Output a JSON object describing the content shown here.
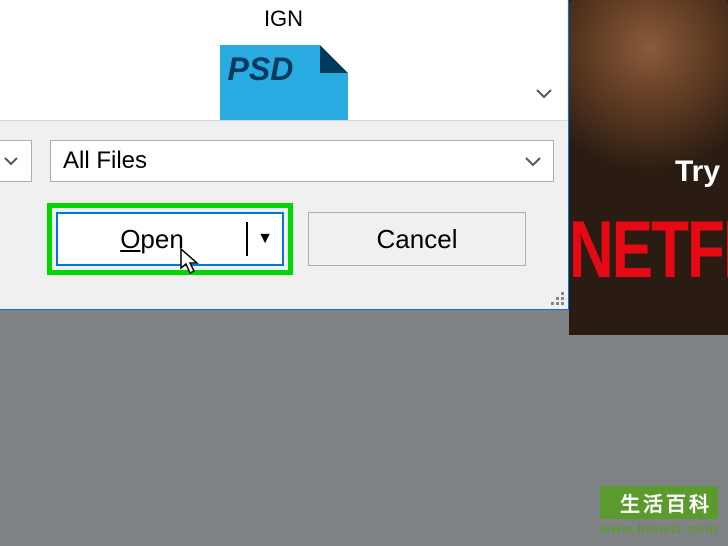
{
  "dialog": {
    "file_name": "IGN",
    "psd_label": "PSD",
    "file_type": "All Files",
    "open_label": "Open",
    "cancel_label": "Cancel"
  },
  "ad": {
    "try_text": "Try",
    "brand": "NETFLIX"
  },
  "watermark": {
    "title": "生活百科",
    "url": "www.bimeiz.com"
  }
}
